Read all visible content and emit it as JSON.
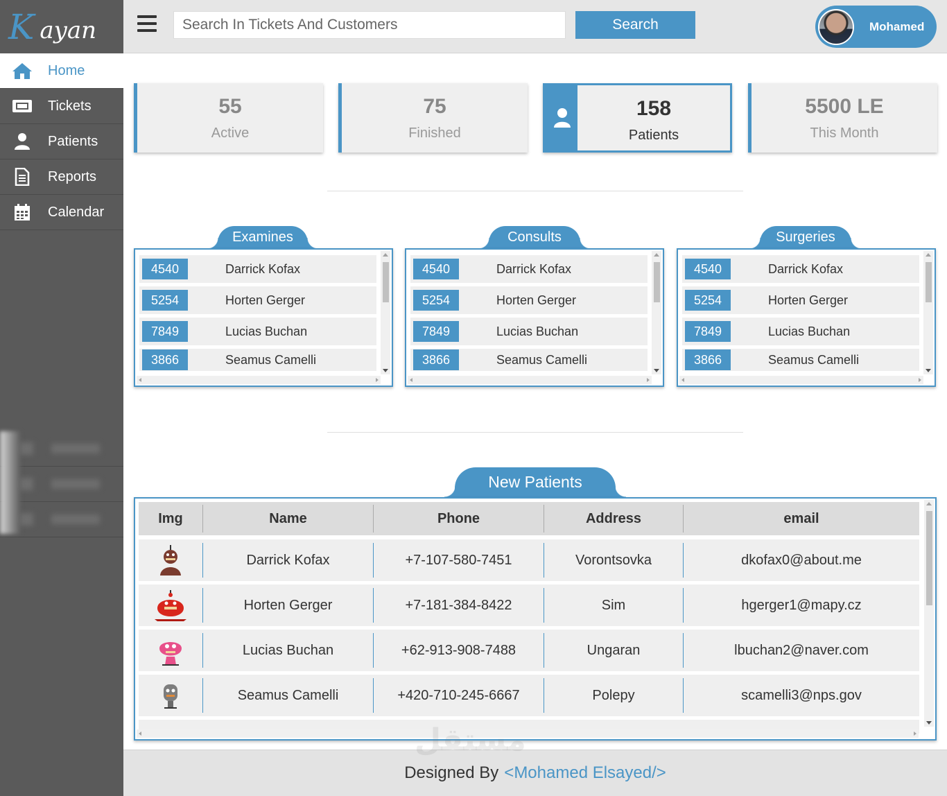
{
  "brand": {
    "logo_letter": "K",
    "logo_rest": "ayan"
  },
  "sidebar": {
    "items": [
      {
        "label": "Home",
        "icon": "home-icon",
        "active": true
      },
      {
        "label": "Tickets",
        "icon": "ticket-icon",
        "active": false
      },
      {
        "label": "Patients",
        "icon": "user-icon",
        "active": false
      },
      {
        "label": "Reports",
        "icon": "report-icon",
        "active": false
      },
      {
        "label": "Calendar",
        "icon": "calendar-icon",
        "active": false
      }
    ]
  },
  "header": {
    "search_placeholder": "Search In Tickets And Customers",
    "search_button": "Search",
    "user_name": "Mohamed"
  },
  "stats": [
    {
      "value": "55",
      "label": "Active"
    },
    {
      "value": "75",
      "label": "Finished"
    },
    {
      "value": "158",
      "label": "Patients"
    },
    {
      "value": "5500 LE",
      "label": "This Month"
    }
  ],
  "lists": [
    {
      "title": "Examines",
      "rows": [
        {
          "id": "4540",
          "name": "Darrick Kofax"
        },
        {
          "id": "5254",
          "name": "Horten Gerger"
        },
        {
          "id": "7849",
          "name": "Lucias Buchan"
        },
        {
          "id": "3866",
          "name": "Seamus Camelli"
        }
      ]
    },
    {
      "title": "Consults",
      "rows": [
        {
          "id": "4540",
          "name": "Darrick Kofax"
        },
        {
          "id": "5254",
          "name": "Horten Gerger"
        },
        {
          "id": "7849",
          "name": "Lucias Buchan"
        },
        {
          "id": "3866",
          "name": "Seamus Camelli"
        }
      ]
    },
    {
      "title": "Surgeries",
      "rows": [
        {
          "id": "4540",
          "name": "Darrick Kofax"
        },
        {
          "id": "5254",
          "name": "Horten Gerger"
        },
        {
          "id": "7849",
          "name": "Lucias Buchan"
        },
        {
          "id": "3866",
          "name": "Seamus Camelli"
        }
      ]
    }
  ],
  "new_patients": {
    "title": "New Patients",
    "columns": [
      "Img",
      "Name",
      "Phone",
      "Address",
      "email"
    ],
    "rows": [
      {
        "avatar_color": "#7a3b2e",
        "name": "Darrick Kofax",
        "phone": "+7-107-580-7451",
        "address": "Vorontsovka",
        "email": "dkofax0@about.me"
      },
      {
        "avatar_color": "#d8261c",
        "name": "Horten Gerger",
        "phone": "+7-181-384-8422",
        "address": "Sim",
        "email": "hgerger1@mapy.cz"
      },
      {
        "avatar_color": "#e8508a",
        "name": "Lucias Buchan",
        "phone": "+62-913-908-7488",
        "address": "Ungaran",
        "email": "lbuchan2@naver.com"
      },
      {
        "avatar_color": "#7d7d7d",
        "name": "Seamus Camelli",
        "phone": "+420-710-245-6667",
        "address": "Polepy",
        "email": "scamelli3@nps.gov"
      }
    ]
  },
  "footer": {
    "prefix": "Designed By",
    "author": "<Mohamed Elsayed/>"
  },
  "watermark": "مستقل",
  "colors": {
    "accent": "#4a95c6",
    "sidebar": "#5a5a5a",
    "card": "#efefef"
  }
}
